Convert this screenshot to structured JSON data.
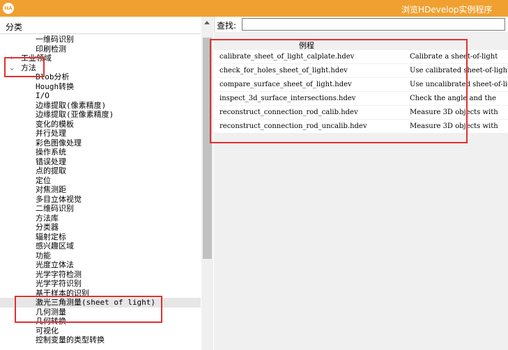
{
  "window": {
    "title": "浏览HDevelop实例程序",
    "icon_text": "HA"
  },
  "left_panel": {
    "header": "分类",
    "tree": [
      {
        "label": "一维码识别",
        "level": 1
      },
      {
        "label": "印刷检测",
        "level": 1
      },
      {
        "label": "工业领域",
        "level": 0,
        "toggle": "›"
      },
      {
        "label": "方法",
        "level": 0,
        "toggle": "⌄"
      },
      {
        "label": "Blob分析",
        "level": 1
      },
      {
        "label": "Hough转换",
        "level": 1
      },
      {
        "label": "I/O",
        "level": 1
      },
      {
        "label": "边缘提取(像素精度)",
        "level": 1
      },
      {
        "label": "边缘提取(亚像素精度)",
        "level": 1
      },
      {
        "label": "变化的模板",
        "level": 1
      },
      {
        "label": "并行处理",
        "level": 1
      },
      {
        "label": "彩色图像处理",
        "level": 1
      },
      {
        "label": "操作系统",
        "level": 1
      },
      {
        "label": "错误处理",
        "level": 1
      },
      {
        "label": "点的提取",
        "level": 1
      },
      {
        "label": "定位",
        "level": 1
      },
      {
        "label": "对焦测距",
        "level": 1
      },
      {
        "label": "多目立体视觉",
        "level": 1
      },
      {
        "label": "二维码识别",
        "level": 1
      },
      {
        "label": "方法库",
        "level": 1
      },
      {
        "label": "分类器",
        "level": 1
      },
      {
        "label": "辐射定标",
        "level": 1
      },
      {
        "label": "感兴趣区域",
        "level": 1
      },
      {
        "label": "功能",
        "level": 1
      },
      {
        "label": "光度立体法",
        "level": 1
      },
      {
        "label": "光学字符检测",
        "level": 1
      },
      {
        "label": "光学字符识别",
        "level": 1
      },
      {
        "label": "基于样本的识别",
        "level": 1
      },
      {
        "label": "激光三角测量(sheet of light)",
        "level": 1,
        "selected": true
      },
      {
        "label": "几何测量",
        "level": 1
      },
      {
        "label": "几何转换",
        "level": 1
      },
      {
        "label": "可视化",
        "level": 1
      },
      {
        "label": "控制变量的类型转换",
        "level": 1
      }
    ]
  },
  "search": {
    "label": "查找:",
    "value": ""
  },
  "examples": {
    "column_header": "例程",
    "rows": [
      {
        "file": "calibrate_sheet_of_light_calplate.hdev",
        "desc": "Calibrate a sheet-of-light"
      },
      {
        "file": "check_for_holes_sheet_of_light.hdev",
        "desc": "Use calibrated sheet-of-light"
      },
      {
        "file": "compare_surface_sheet_of_light.hdev",
        "desc": "Use uncalibrated sheet-of-light"
      },
      {
        "file": "inspect_3d_surface_intersections.hdev",
        "desc": "Check the angle and the"
      },
      {
        "file": "reconstruct_connection_rod_calib.hdev",
        "desc": "Measure 3D objects with"
      },
      {
        "file": "reconstruct_connection_rod_uncalib.hdev",
        "desc": "Measure 3D objects with"
      }
    ]
  },
  "colors": {
    "titlebar": "#f0a030",
    "highlight_box": "#e03030",
    "selected_row": "#e6e6e6"
  }
}
